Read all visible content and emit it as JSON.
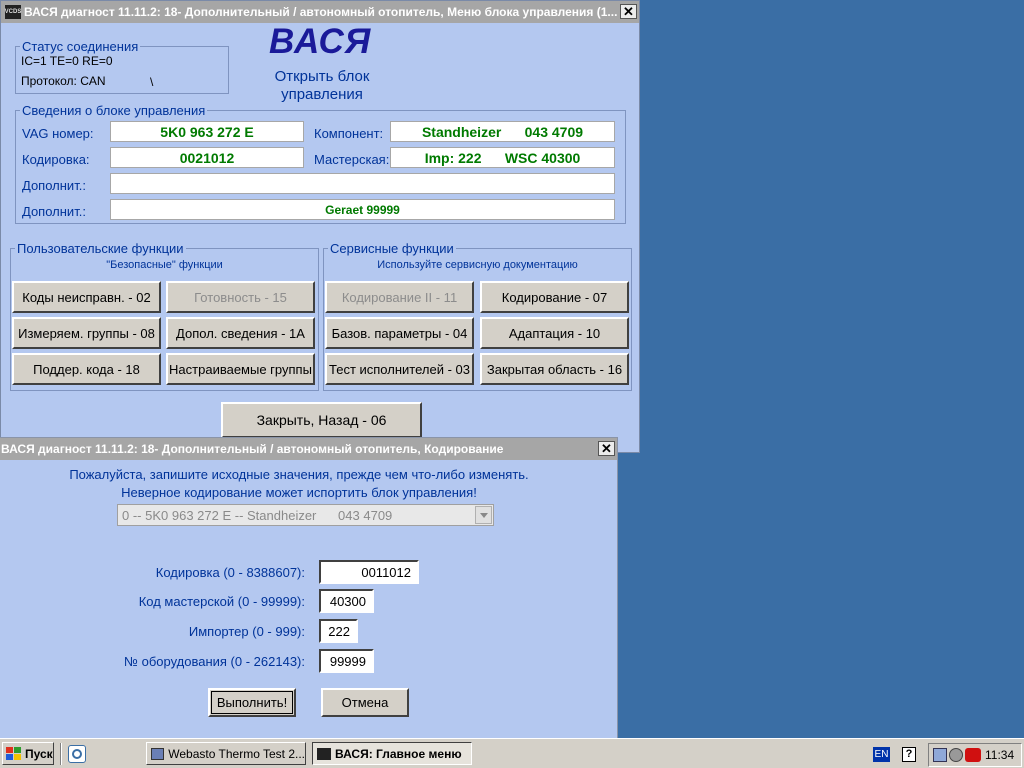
{
  "main_window": {
    "title": "ВАСЯ диагност 11.11.2: 18- Дополнительный / автономный отопитель,  Меню блока управления (1...",
    "close_glyph": "✕",
    "app_icon": "app-icon",
    "logo": "ВАСЯ",
    "open_block_line1": "Открыть блок",
    "open_block_line2": "управления",
    "status": {
      "legend": "Статус соединения",
      "line1": "IC=1  TE=0   RE=0",
      "protocol": "Протокол: CAN",
      "spinner": "\\"
    },
    "info": {
      "legend": "Сведения о блоке управления",
      "vag_label": "VAG номер:",
      "vag_value": "5K0 963 272 E",
      "component_label": "Компонент:",
      "component_value": "Standheizer      043 4709",
      "coding_label": "Кодировка:",
      "coding_value": "0021012",
      "workshop_label": "Мастерская:",
      "workshop_value": "Imp: 222      WSC 40300",
      "extra1_label": "Дополнит.:",
      "extra1_value": "",
      "extra2_label": "Дополнит.:",
      "extra2_value": "Geraet 99999"
    },
    "user_functions": {
      "legend": "Пользовательские функции",
      "subtitle": "\"Безопасные\" функции",
      "buttons": [
        "Коды неисправн. - 02",
        "Готовность - 15",
        "Измеряем. группы - 08",
        "Допол. сведения - 1A",
        "Поддер. кода - 18",
        "Настраиваемые группы"
      ]
    },
    "service_functions": {
      "legend": "Сервисные функции",
      "subtitle": "Используйте сервисную документацию",
      "buttons": [
        "Кодирование II - 11",
        "Кодирование - 07",
        "Базов. параметры - 04",
        "Адаптация - 10",
        "Тест исполнителей - 03",
        "Закрытая область - 16"
      ]
    },
    "close_back": "Закрыть, Назад - 06"
  },
  "coding_dialog": {
    "title": "ВАСЯ диагност 11.11.2: 18- Дополнительный / автономный отопитель,  Кодирование",
    "close_glyph": "✕",
    "warning_line1": "Пожалуйста, запишите исходные значения, прежде чем что-либо изменять.",
    "warning_line2": "Неверное кодирование может испортить блок управления!",
    "dropdown_value": "0 -- 5K0 963 272 E -- Standheizer      043 4709",
    "fields": [
      {
        "label": "Кодировка (0 - 8388607):",
        "value": "0011012"
      },
      {
        "label": "Код мастерской (0 - 99999):",
        "value": "40300"
      },
      {
        "label": "Импортер (0 - 999):",
        "value": "222"
      },
      {
        "label": "№ оборудования (0 - 262143):",
        "value": "99999"
      }
    ],
    "execute_label": "Выполнить!",
    "cancel_label": "Отмена"
  },
  "taskbar": {
    "start_label": "Пуск",
    "quicklaunch_icon": "desktop-icon",
    "tasks": [
      {
        "label": "Webasto Thermo Test 2...",
        "active": false
      },
      {
        "label": "ВАСЯ:  Главное меню",
        "active": true
      }
    ],
    "lang": "EN",
    "help": "?",
    "clock": "11:34"
  },
  "colors": {
    "desktop": "#3a6ea5",
    "window_bg": "#b4c8f0",
    "label_text": "#003399",
    "value_text": "#007a00",
    "logo": "#1a1a99"
  }
}
